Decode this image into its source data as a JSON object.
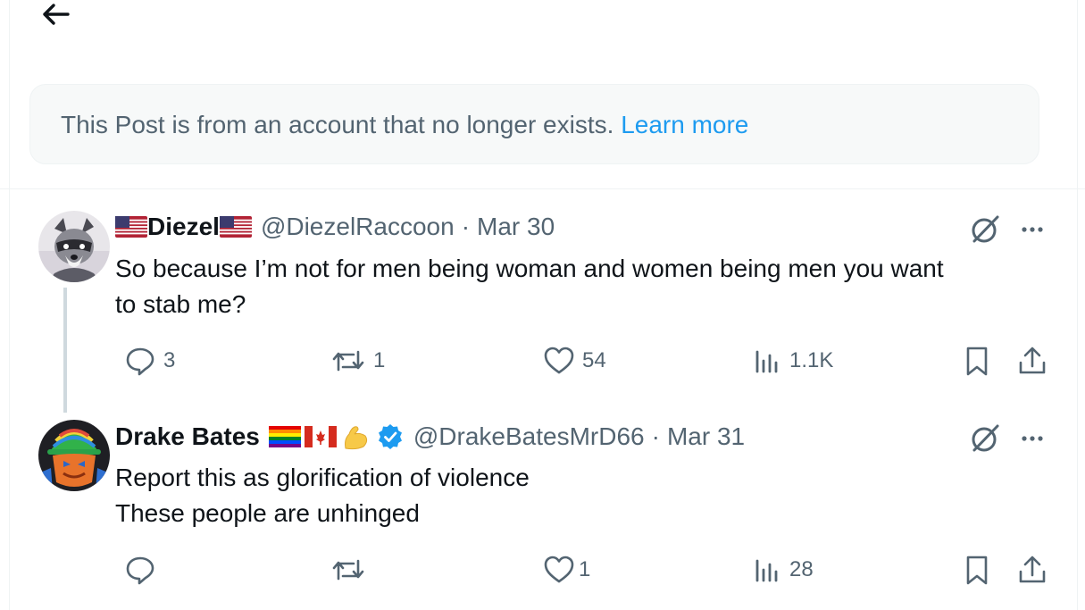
{
  "notice": {
    "text": "This Post is from an account that no longer exists.",
    "link": "Learn more"
  },
  "posts": [
    {
      "name": "Diezel",
      "handle": "@DiezelRaccoon",
      "separator": "·",
      "date": "Mar 30",
      "lines": [
        "So because I’m not for men being woman and women being men you want",
        "to stab me?"
      ],
      "counts": {
        "replies": "3",
        "reposts": "1",
        "likes": "54",
        "views": "1.1K"
      }
    },
    {
      "name": "Drake Bates",
      "handle": "@DrakeBatesMrD66",
      "separator": "·",
      "date": "Mar 31",
      "lines": [
        "Report this as glorification of violence",
        "These people are unhinged"
      ],
      "counts": {
        "replies": "",
        "reposts": "",
        "likes": "1",
        "views": "28"
      },
      "badge": "verified-icon",
      "emoji": [
        "rainbow-flag",
        "canada-flag",
        "flexed-biceps"
      ]
    }
  ],
  "colors": {
    "accent": "#1d9bf0",
    "muted": "#536471",
    "text": "#0f1419"
  }
}
